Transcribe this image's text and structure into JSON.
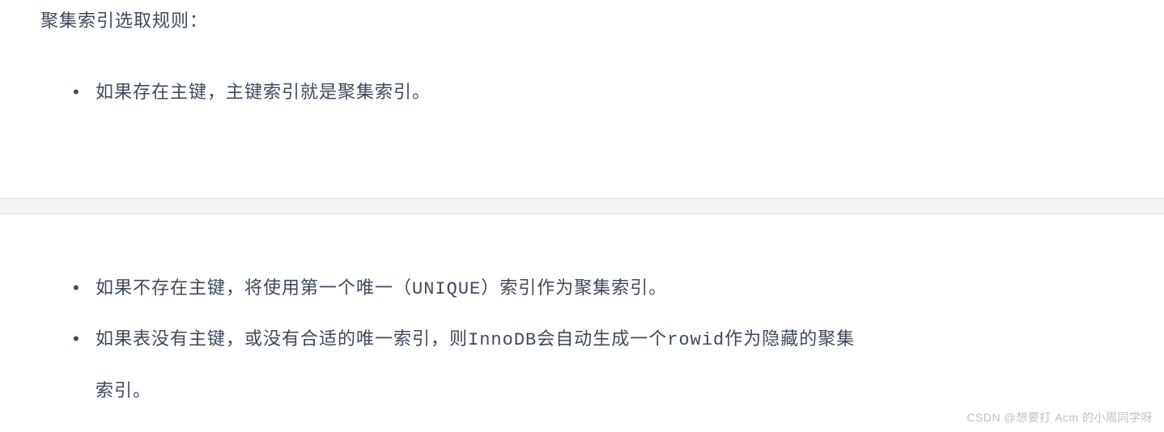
{
  "top_section": {
    "heading": "聚集索引选取规则：",
    "items": [
      "如果存在主键，主键索引就是聚集索引。"
    ]
  },
  "bottom_section": {
    "items": [
      {
        "prefix": "如果不存在主键，将使用第一个唯一（",
        "code1": "UNIQUE",
        "suffix": "）索引作为聚集索引。"
      },
      {
        "prefix": "如果表没有主键，或没有合适的唯一索引，则",
        "code1": "InnoDB",
        "mid": "会自动生成一个",
        "code2": "rowid",
        "suffix": "作为隐藏的聚集索引。"
      }
    ]
  },
  "watermark": "CSDN @想要打 Acm 的小周同学呀"
}
